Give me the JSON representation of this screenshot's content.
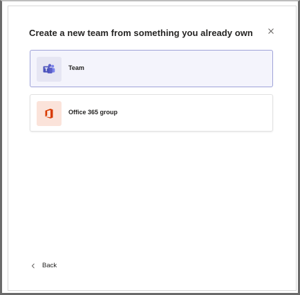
{
  "dialog": {
    "title": "Create a new team from something you already own",
    "close_icon": "close-icon"
  },
  "options": [
    {
      "label": "Team",
      "icon": "teams-icon",
      "selected": true
    },
    {
      "label": "Office 365 group",
      "icon": "office-icon",
      "selected": false
    }
  ],
  "footer": {
    "back_label": "Back",
    "back_icon": "chevron-left-icon"
  },
  "colors": {
    "teams_purple": "#5b5fc7",
    "office_red": "#d83b01",
    "selected_border": "#9ea2d8"
  }
}
